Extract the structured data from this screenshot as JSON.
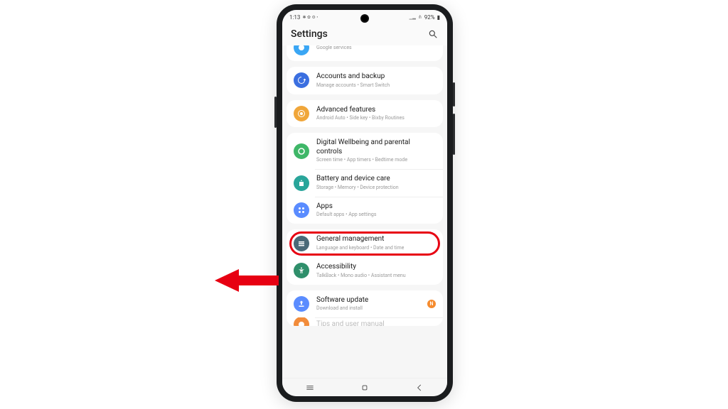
{
  "status": {
    "time": "1:13",
    "icons_left": "✱ ✿ ⚙ •",
    "signal": "▁▂",
    "wifi": "⋔",
    "battery_pct": "92%",
    "battery_icon": "▮"
  },
  "header": {
    "title": "Settings"
  },
  "rows": {
    "google": {
      "title": "",
      "sub": "Google services"
    },
    "accounts": {
      "title": "Accounts and backup",
      "sub": "Manage accounts • Smart Switch"
    },
    "advanced": {
      "title": "Advanced features",
      "sub": "Android Auto • Side key • Bixby Routines"
    },
    "wellbeing": {
      "title": "Digital Wellbeing and parental controls",
      "sub": "Screen time • App timers • Bedtime mode"
    },
    "battery": {
      "title": "Battery and device care",
      "sub": "Storage • Memory • Device protection"
    },
    "apps": {
      "title": "Apps",
      "sub": "Default apps • App settings"
    },
    "general": {
      "title": "General management",
      "sub": "Language and keyboard • Date and time"
    },
    "accessibility": {
      "title": "Accessibility",
      "sub": "TalkBack • Mono audio • Assistant menu"
    },
    "software": {
      "title": "Software update",
      "sub": "Download and install",
      "badge": "N"
    },
    "tips": {
      "title": "Tips and user manual",
      "sub": ""
    }
  },
  "colors": {
    "google": "#3aa6f4",
    "accounts": "#3b6fe0",
    "advanced": "#f0a63a",
    "wellbeing": "#3fb768",
    "battery": "#29a59a",
    "apps": "#5a8cff",
    "general": "#4a6a78",
    "accessibility": "#2f8f6b",
    "software": "#5a8cff",
    "tips": "#f28c3b",
    "highlight": "#e70012"
  }
}
